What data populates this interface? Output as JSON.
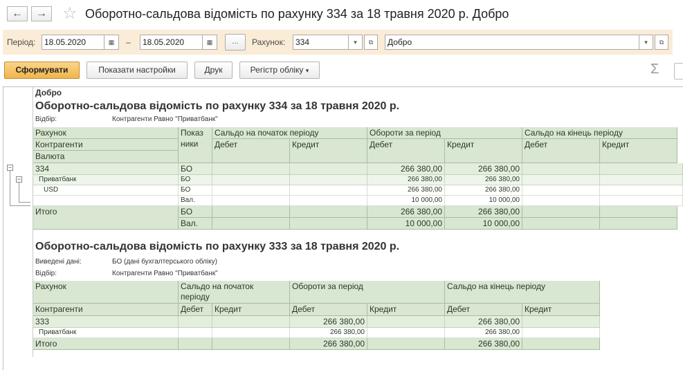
{
  "window": {
    "title": "Оборотно-сальдова відомість по рахунку 334 за 18 травня 2020 р. Добро",
    "back_icon": "←",
    "forward_icon": "→",
    "star_icon": "☆"
  },
  "params": {
    "period_label": "Період:",
    "date_from": "18.05.2020",
    "dash": "–",
    "date_to": "18.05.2020",
    "more_label": "...",
    "account_label": "Рахунок:",
    "account_value": "334",
    "org_value": "Добро"
  },
  "toolbar": {
    "generate_label": "Сформувати",
    "settings_label": "Показати настройки",
    "print_label": "Друк",
    "register_label": "Регістр обліку",
    "sigma_icon": "Σ"
  },
  "report1": {
    "org": "Добро",
    "title": "Оборотно-сальдова відомість по рахунку 334 за 18 травня 2020 р.",
    "filter_label": "Відбір:",
    "filter_value": "Контрагенти Равно \"Приватбанк\"",
    "headers": {
      "account": "Рахунок",
      "contractors": "Контрагенти",
      "currency": "Валюта",
      "indicator": "Показ ники",
      "opening": "Сальдо на початок періоду",
      "turnover": "Обороти за період",
      "closing": "Сальдо на кінець періоду",
      "debit": "Дебет",
      "credit": "Кредит"
    },
    "rows": [
      {
        "name": "334",
        "ind": "БО",
        "od": "",
        "oc": "",
        "td": "266 380,00",
        "tc": "266 380,00",
        "cd": "",
        "cc": ""
      },
      {
        "name": "Приватбанк",
        "ind": "БО",
        "od": "",
        "oc": "",
        "td": "266 380,00",
        "tc": "266 380,00",
        "cd": "",
        "cc": ""
      },
      {
        "name": "USD",
        "ind": "БО",
        "od": "",
        "oc": "",
        "td": "266 380,00",
        "tc": "266 380,00",
        "cd": "",
        "cc": ""
      },
      {
        "name": "",
        "ind": "Вал.",
        "od": "",
        "oc": "",
        "td": "10 000,00",
        "tc": "10 000,00",
        "cd": "",
        "cc": ""
      }
    ],
    "total": {
      "label": "Итого",
      "ind1": "БО",
      "td1": "266 380,00",
      "tc1": "266 380,00",
      "ind2": "Вал.",
      "td2": "10 000,00",
      "tc2": "10 000,00"
    }
  },
  "report2": {
    "title": "Оборотно-сальдова відомість по рахунку 333 за 18 травня 2020 р.",
    "data_label": "Виведені дані:",
    "data_value": "БО (дані бухгалтерського обліку)",
    "filter_label": "Відбір:",
    "filter_value": "Контрагенти Равно \"Приватбанк\"",
    "headers": {
      "account": "Рахунок",
      "contractors": "Контрагенти",
      "opening_1": "Сальдо на початок",
      "opening_2": "періоду",
      "turnover": "Обороти за період",
      "closing": "Сальдо на кінець періоду",
      "debit": "Дебет",
      "credit": "Кредит"
    },
    "rows": [
      {
        "name": "333",
        "od": "",
        "oc": "",
        "td": "266 380,00",
        "tc": "",
        "cd": "266 380,00",
        "cc": ""
      },
      {
        "name": "Приватбанк",
        "od": "",
        "oc": "",
        "td": "266 380,00",
        "tc": "",
        "cd": "266 380,00",
        "cc": ""
      }
    ],
    "total": {
      "label": "Итого",
      "od": "",
      "oc": "",
      "td": "266 380,00",
      "tc": "",
      "cd": "266 380,00",
      "cc": ""
    }
  }
}
